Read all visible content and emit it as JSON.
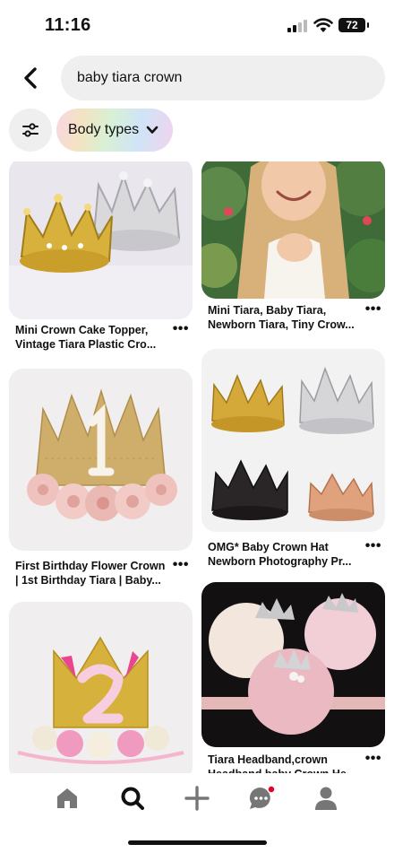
{
  "status_bar": {
    "time": "11:16",
    "battery": "72"
  },
  "search": {
    "query": "baby tiara crown"
  },
  "filters": {
    "chip_label": "Body types"
  },
  "pins": [
    {
      "title": "Mini Crown Cake Topper,\nVintage Tiara Plastic Cro..."
    },
    {
      "title": "Mini Tiara, Baby Tiara,\nNewborn Tiara, Tiny Crow..."
    },
    {
      "title": "First Birthday Flower Crown\n| 1st Birthday Tiara | Baby..."
    },
    {
      "title": "OMG* Baby Crown Hat\nNewborn Photography Pr..."
    },
    {
      "title": ""
    },
    {
      "title": "Tiara Headband,crown\nHeadband,baby Crown He..."
    }
  ],
  "more_label": "•••",
  "colors": {
    "accent_red": "#e60023",
    "text": "#111111",
    "surface": "#efefef"
  }
}
